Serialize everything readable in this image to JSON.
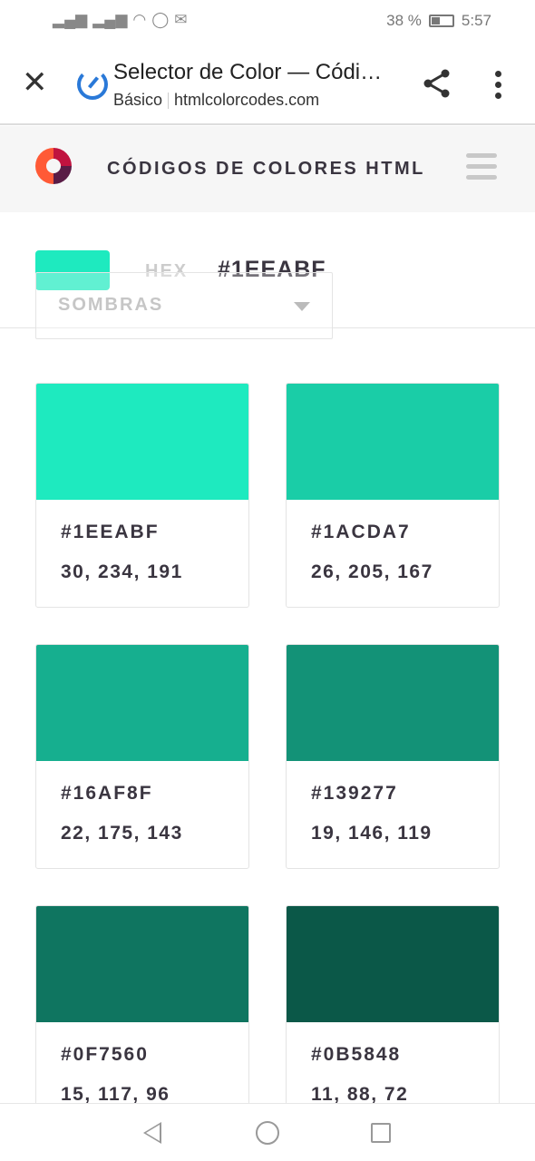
{
  "status": {
    "battery": "38 %",
    "time": "5:57",
    "battery_level": 38
  },
  "browser": {
    "title": "Selector de Color — Códi…",
    "mode": "Básico",
    "domain": "htmlcolorcodes.com"
  },
  "site": {
    "brand": "CÓDIGOS DE COLORES HTML"
  },
  "picker": {
    "format_label": "HEX",
    "value": "#1EEABF",
    "swatch": "#1eeabf",
    "dropdown": "SOMBRAS"
  },
  "shades": [
    {
      "hex": "#1EEABF",
      "rgb": "30, 234, 191",
      "color": "#1eeabf"
    },
    {
      "hex": "#1ACDA7",
      "rgb": "26, 205, 167",
      "color": "#1acda7"
    },
    {
      "hex": "#16AF8F",
      "rgb": "22, 175, 143",
      "color": "#16af8f"
    },
    {
      "hex": "#139277",
      "rgb": "19, 146, 119",
      "color": "#139277"
    },
    {
      "hex": "#0F7560",
      "rgb": "15, 117, 96",
      "color": "#0f7560"
    },
    {
      "hex": "#0B5848",
      "rgb": "11, 88, 72",
      "color": "#0b5848"
    }
  ]
}
